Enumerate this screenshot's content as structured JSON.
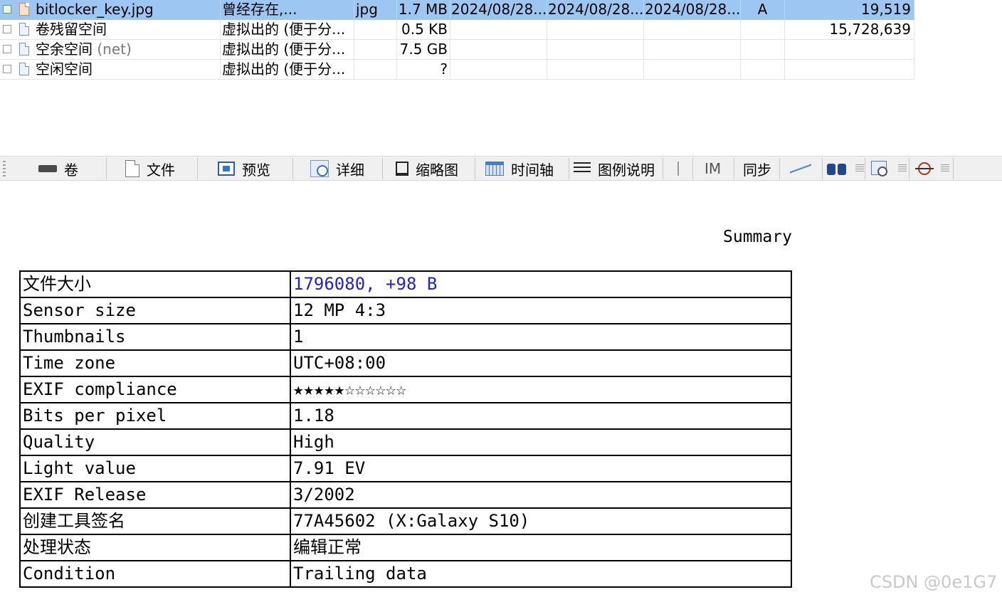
{
  "file_list": {
    "rows": [
      {
        "name": "bitlocker_key.jpg",
        "name_suffix": "",
        "type": "曾经存在,...",
        "ext": "jpg",
        "size": "1.7 MB",
        "created": "2024/08/28...",
        "modified": "2024/08/28...",
        "accessed": "2024/08/28...",
        "attr": "A",
        "sector": "19,519",
        "icon": "image-file-icon"
      },
      {
        "name": "卷残留空间",
        "name_suffix": "",
        "type": "虚拟出的 (便于分...",
        "ext": "",
        "size": "0.5 KB",
        "created": "",
        "modified": "",
        "accessed": "",
        "attr": "",
        "sector": "15,728,639",
        "icon": "virtual-file-icon"
      },
      {
        "name": "空余空间",
        "name_suffix": "(net)",
        "type": "虚拟出的 (便于分...",
        "ext": "",
        "size": "7.5 GB",
        "created": "",
        "modified": "",
        "accessed": "",
        "attr": "",
        "sector": "",
        "icon": "virtual-file-icon"
      },
      {
        "name": "空闲空间",
        "name_suffix": "",
        "type": "虚拟出的 (便于分...",
        "ext": "",
        "size": "?",
        "created": "",
        "modified": "",
        "accessed": "",
        "attr": "",
        "sector": "",
        "icon": "virtual-file-icon"
      }
    ]
  },
  "toolbar": {
    "volume": "卷",
    "file": "文件",
    "preview": "预览",
    "details": "详细",
    "thumbnails": "缩略图",
    "timeline": "时间轴",
    "legend": "图例说明",
    "im": "IM",
    "sync": "同步"
  },
  "summary": {
    "title": "Summary",
    "rows": [
      {
        "key": "文件大小",
        "value": "1796080, +98 B"
      },
      {
        "key": "Sensor size",
        "value": "12 MP 4:3"
      },
      {
        "key": "Thumbnails",
        "value": "1"
      },
      {
        "key": "Time zone",
        "value": "UTC+08:00"
      },
      {
        "key": "EXIF compliance",
        "value": "★★★★★☆☆☆☆☆☆"
      },
      {
        "key": "Bits per pixel",
        "value": "1.18"
      },
      {
        "key": "Quality",
        "value": "High"
      },
      {
        "key": "Light value",
        "value": "7.91 EV"
      },
      {
        "key": "EXIF Release",
        "value": "3/2002"
      },
      {
        "key": "创建工具签名",
        "value": "77A45602 (X:Galaxy S10)"
      },
      {
        "key": "处理状态",
        "value": "编辑正常"
      },
      {
        "key": "Condition",
        "value": "Trailing data"
      }
    ]
  },
  "watermark": "CSDN @0e1G7"
}
